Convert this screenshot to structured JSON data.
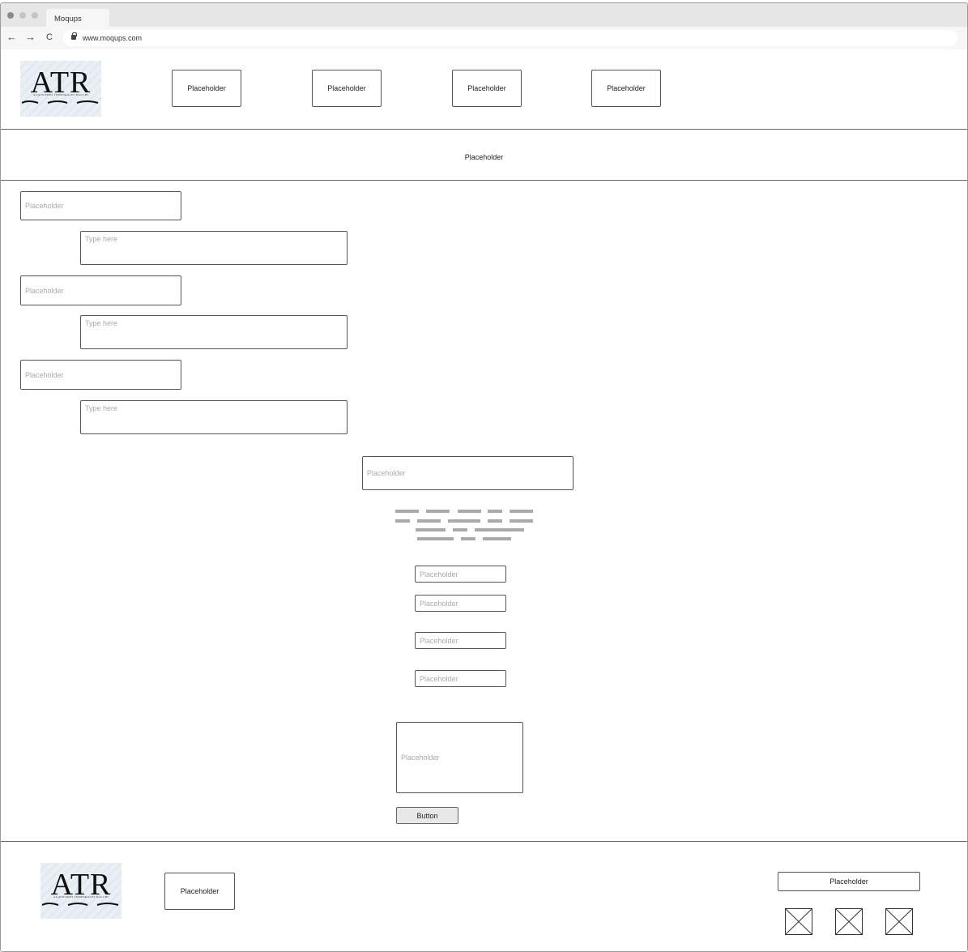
{
  "browser": {
    "tab_title": "Moqups",
    "url": "www.moqups.com",
    "nav": {
      "back": "←",
      "forward": "→",
      "reload": "C"
    }
  },
  "header": {
    "logo": {
      "text": "ATR",
      "subtitle": "ALQUILERES TEMPORALES DACCHI"
    },
    "nav_items": [
      "Placeholder",
      "Placeholder",
      "Placeholder",
      "Placeholder"
    ]
  },
  "banner": {
    "text": "Placeholder"
  },
  "form": {
    "groups": [
      {
        "label_placeholder": "Placeholder",
        "textarea_placeholder": "Type here"
      },
      {
        "label_placeholder": "Placeholder",
        "textarea_placeholder": "Type here"
      },
      {
        "label_placeholder": "Placeholder",
        "textarea_placeholder": "Type here"
      }
    ]
  },
  "center": {
    "heading_placeholder": "Placeholder",
    "inputs": [
      "Placeholder",
      "Placeholder",
      "Placeholder",
      "Placeholder"
    ],
    "message_placeholder": "Placeholder",
    "button_label": "Button"
  },
  "footer": {
    "logo": {
      "text": "ATR",
      "subtitle": "ALQUILERES TEMPORALES DACCHI"
    },
    "link": "Placeholder",
    "right_box": "Placeholder",
    "social_icons": [
      "image-placeholder-icon",
      "image-placeholder-icon",
      "image-placeholder-icon"
    ]
  },
  "colors": {
    "chrome": "#e6e6e6",
    "border": "#555555",
    "placeholder_text": "#aaaaaa"
  }
}
